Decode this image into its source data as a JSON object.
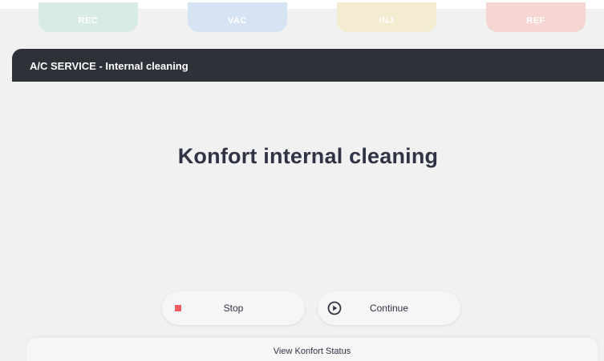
{
  "mode_tabs": [
    {
      "label": "REC",
      "color": "#d8ebe4"
    },
    {
      "label": "VAC",
      "color": "#d6e3f3"
    },
    {
      "label": "INJ",
      "color": "#f4ecd0"
    },
    {
      "label": "REF",
      "color": "#f5d6d2"
    }
  ],
  "header": {
    "title": "A/C SERVICE - Internal cleaning",
    "background": "#2e3238"
  },
  "main": {
    "heading": "Konfort internal cleaning"
  },
  "actions": {
    "stop_label": "Stop",
    "stop_icon": "stop-icon",
    "stop_icon_color": "#f25b66",
    "continue_label": "Continue",
    "continue_icon": "play-circle-icon"
  },
  "footer": {
    "status_label": "View Konfort Status"
  }
}
